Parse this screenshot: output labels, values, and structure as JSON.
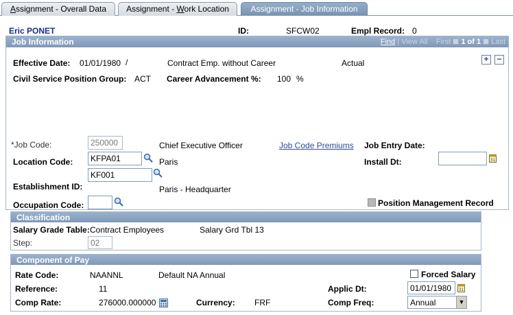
{
  "tabs": [
    {
      "pre": "",
      "key": "A",
      "post": "ssignment - Overall Data"
    },
    {
      "pre": "Assignment - ",
      "key": "W",
      "post": "ork Location"
    },
    {
      "label": "Assignment - Job Information"
    }
  ],
  "header": {
    "name": "Eric PONET",
    "id_label": "ID:",
    "id_value": "SFCW02",
    "empl_record_label": "Empl Record:",
    "empl_record_value": "0"
  },
  "job_info": {
    "title": "Job Information",
    "nav": {
      "find": "Find",
      "view_all": "View All",
      "first": "First",
      "count": "1 of 1",
      "last": "Last"
    },
    "add_label": "+",
    "delete_label": "−",
    "effective_date_label": "Effective Date:",
    "effective_date_value": "01/01/1980",
    "effective_sequence": "/",
    "contract_type": "Contract Emp. without Career",
    "status": "Actual",
    "csp_group_label": "Civil Service Position Group:",
    "csp_group_value": "ACT",
    "career_adv_label": "Career Advancement %:",
    "career_adv_value": "100",
    "career_adv_unit": "%",
    "job_code_label": "*Job Code:",
    "job_code_value": "250000",
    "job_code_desc": "Chief Executive Officer",
    "job_code_premiums_link": "Job Code Premiums",
    "job_entry_date_label": "Job Entry Date:",
    "location_code_label": "Location Code:",
    "location_code_value": "KFPA01",
    "location_desc": "Paris",
    "install_dt_label": "Install Dt:",
    "install_dt_value": "",
    "establishment_label": "Establishment ID:",
    "establishment_value": "KF001",
    "establishment_desc": "Paris - Headquarter",
    "occupation_label": "Occupation Code:",
    "occupation_value": "",
    "position_mgmt_label": "Position Management Record"
  },
  "classification": {
    "title": "Classification",
    "salary_grade_label": "Salary Grade Table:",
    "salary_grade_value": "Contract Employees",
    "salary_grade_tbl": "Salary Grd Tbl 13",
    "step_label": "Step:",
    "step_value": "02"
  },
  "component_of_pay": {
    "title": "Component of Pay",
    "rate_code_label": "Rate Code:",
    "rate_code_value": "NAANNL",
    "rate_code_desc": "Default NA Annual",
    "forced_salary_label": "Forced Salary",
    "reference_label": "Reference:",
    "reference_value": "11",
    "applic_dt_label": "Applic Dt:",
    "applic_dt_value": "01/01/1980",
    "comp_rate_label": "Comp Rate:",
    "comp_rate_value": "276000.000000",
    "currency_label": "Currency:",
    "currency_value": "FRF",
    "comp_freq_label": "Comp Freq:",
    "comp_freq_value": "Annual"
  },
  "colors": {
    "header_band": "#8aa3c2",
    "link": "#2a4b9c",
    "name": "#1a2e8c"
  }
}
